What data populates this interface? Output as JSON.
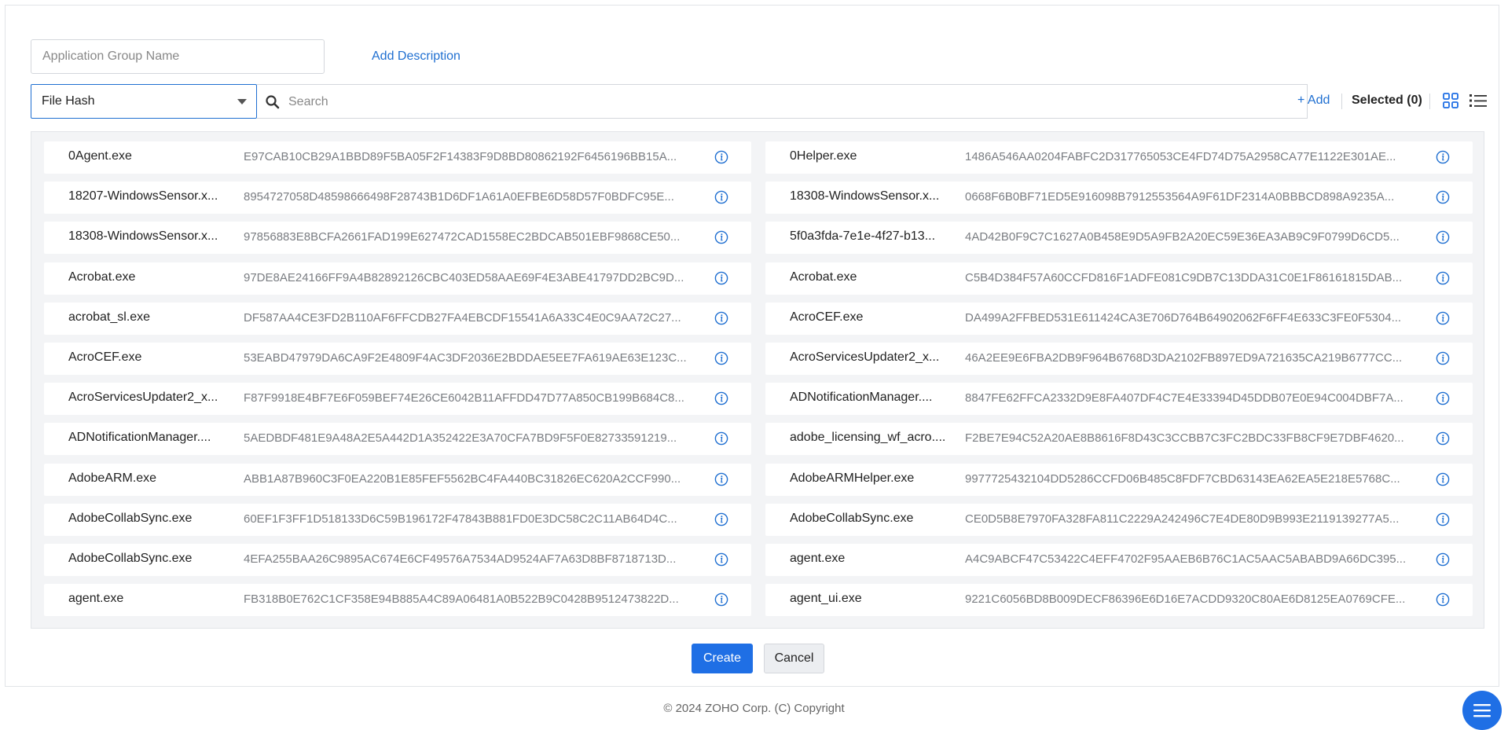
{
  "form": {
    "name_placeholder": "Application Group Name",
    "add_description": "Add Description"
  },
  "toolbar": {
    "type_selected": "File Hash",
    "search_placeholder": "Search",
    "add_label": "+ Add",
    "selected_label": "Selected (0)"
  },
  "apps": [
    {
      "name": "0Agent.exe",
      "hash": "E97CAB10CB29A1BBD89F5BA05F2F14383F9D8BD80862192F6456196BB15A..."
    },
    {
      "name": "0Helper.exe",
      "hash": "1486A546AA0204FABFC2D317765053CE4FD74D75A2958CA77E1122E301AE..."
    },
    {
      "name": "18207-WindowsSensor.x...",
      "hash": "8954727058D48598666498F28743B1D6DF1A61A0EFBE6D58D57F0BDFC95E..."
    },
    {
      "name": "18308-WindowsSensor.x...",
      "hash": "0668F6B0BF71ED5E916098B7912553564A9F61DF2314A0BBBCD898A9235A..."
    },
    {
      "name": "18308-WindowsSensor.x...",
      "hash": "97856883E8BCFA2661FAD199E627472CAD1558EC2BDCAB501EBF9868CE50..."
    },
    {
      "name": "5f0a3fda-7e1e-4f27-b13...",
      "hash": "4AD42B0F9C7C1627A0B458E9D5A9FB2A20EC59E36EA3AB9C9F0799D6CD5..."
    },
    {
      "name": "Acrobat.exe",
      "hash": "97DE8AE24166FF9A4B82892126CBC403ED58AAE69F4E3ABE41797DD2BC9D..."
    },
    {
      "name": "Acrobat.exe",
      "hash": "C5B4D384F57A60CCFD816F1ADFE081C9DB7C13DDA31C0E1F86161815DAB..."
    },
    {
      "name": "acrobat_sl.exe",
      "hash": "DF587AA4CE3FD2B110AF6FFCDB27FA4EBCDF15541A6A33C4E0C9AA72C27..."
    },
    {
      "name": "AcroCEF.exe",
      "hash": "DA499A2FFBED531E611424CA3E706D764B64902062F6FF4E633C3FE0F5304..."
    },
    {
      "name": "AcroCEF.exe",
      "hash": "53EABD47979DA6CA9F2E4809F4AC3DF2036E2BDDAE5EE7FA619AE63E123C..."
    },
    {
      "name": "AcroServicesUpdater2_x...",
      "hash": "46A2EE9E6FBA2DB9F964B6768D3DA2102FB897ED9A721635CA219B6777CC..."
    },
    {
      "name": "AcroServicesUpdater2_x...",
      "hash": "F87F9918E4BF7E6F059BEF74E26CE6042B11AFFDD47D77A850CB199B684C8..."
    },
    {
      "name": "ADNotificationManager....",
      "hash": "8847FE62FFCA2332D9E8FA407DF4C7E4E33394D45DDB07E0E94C004DBF7A..."
    },
    {
      "name": "ADNotificationManager....",
      "hash": "5AEDBDF481E9A48A2E5A442D1A352422E3A70CFA7BD9F5F0E82733591219..."
    },
    {
      "name": "adobe_licensing_wf_acro....",
      "hash": "F2BE7E94C52A20AE8B8616F8D43C3CCBB7C3FC2BDC33FB8CF9E7DBF4620..."
    },
    {
      "name": "AdobeARM.exe",
      "hash": "ABB1A87B960C3F0EA220B1E85FEF5562BC4FA440BC31826EC620A2CCF990..."
    },
    {
      "name": "AdobeARMHelper.exe",
      "hash": "9977725432104DD5286CCFD06B485C8FDF7CBD63143EA62EA5E218E5768C..."
    },
    {
      "name": "AdobeCollabSync.exe",
      "hash": "60EF1F3FF1D518133D6C59B196172F47843B881FD0E3DC58C2C11AB64D4C..."
    },
    {
      "name": "AdobeCollabSync.exe",
      "hash": "CE0D5B8E7970FA328FA811C2229A242496C7E4DE80D9B993E2119139277A5..."
    },
    {
      "name": "AdobeCollabSync.exe",
      "hash": "4EFA255BAA26C9895AC674E6CF49576A7534AD9524AF7A63D8BF8718713D..."
    },
    {
      "name": "agent.exe",
      "hash": "A4C9ABCF47C53422C4EFF4702F95AAEB6B76C1AC5AAC5ABABD9A66DC395..."
    },
    {
      "name": "agent.exe",
      "hash": "FB318B0E762C1CF358E94B885A4C89A06481A0B522B9C0428B9512473822D..."
    },
    {
      "name": "agent_ui.exe",
      "hash": "9221C6056BD8B009DECF86396E6D16E7ACDD9320C80AE6D8125EA0769CFE..."
    }
  ],
  "actions": {
    "create": "Create",
    "cancel": "Cancel"
  },
  "footer": {
    "copyright": "© 2024 ZOHO Corp. (C) Copyright"
  },
  "colors": {
    "accent": "#1f6fe5",
    "link": "#1f6fd1",
    "panel_bg": "#f3f4f6"
  },
  "icons": {
    "search": "search-icon",
    "info": "info-icon",
    "grid_view": "grid-view-icon",
    "list_view": "list-view-icon",
    "menu": "menu-icon",
    "dropdown": "chevron-down-icon"
  }
}
